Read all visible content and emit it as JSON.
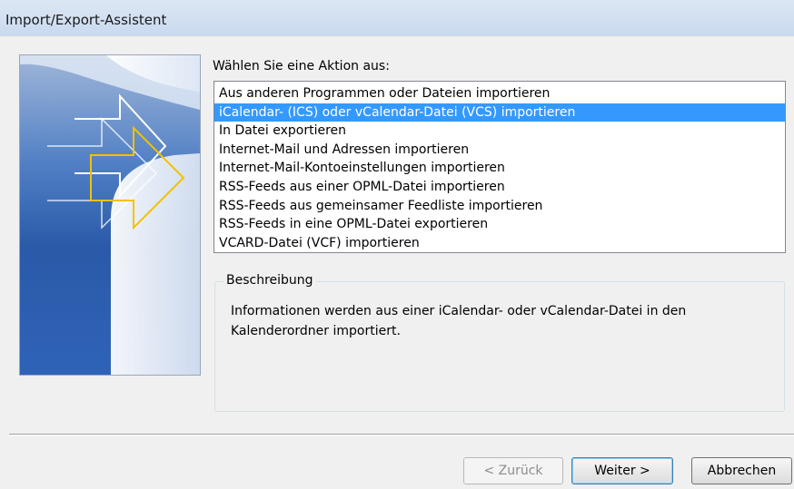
{
  "window": {
    "title": "Import/Export-Assistent"
  },
  "wizard": {
    "prompt": "Wählen Sie eine Aktion aus:",
    "actions": [
      {
        "label": "Aus anderen Programmen oder Dateien importieren"
      },
      {
        "label": "iCalendar- (ICS) oder vCalendar-Datei (VCS) importieren"
      },
      {
        "label": "In Datei exportieren"
      },
      {
        "label": "Internet-Mail und Adressen importieren"
      },
      {
        "label": "Internet-Mail-Kontoeinstellungen importieren"
      },
      {
        "label": "RSS-Feeds aus einer OPML-Datei importieren"
      },
      {
        "label": "RSS-Feeds aus gemeinsamer Feedliste importieren"
      },
      {
        "label": "RSS-Feeds in eine OPML-Datei exportieren"
      },
      {
        "label": "VCARD-Datei (VCF) importieren"
      }
    ],
    "selected_index": 1,
    "description_label": "Beschreibung",
    "description_text": "Informationen werden aus einer iCalendar- oder vCalendar-Datei in den Kalenderordner importiert."
  },
  "buttons": {
    "back": "< Zurück",
    "next": "Weiter >",
    "cancel": "Abbrechen"
  },
  "colors": {
    "selection": "#3399ff",
    "art_blue": "#1f4fa0",
    "arrow_yellow": "#f2c200"
  }
}
